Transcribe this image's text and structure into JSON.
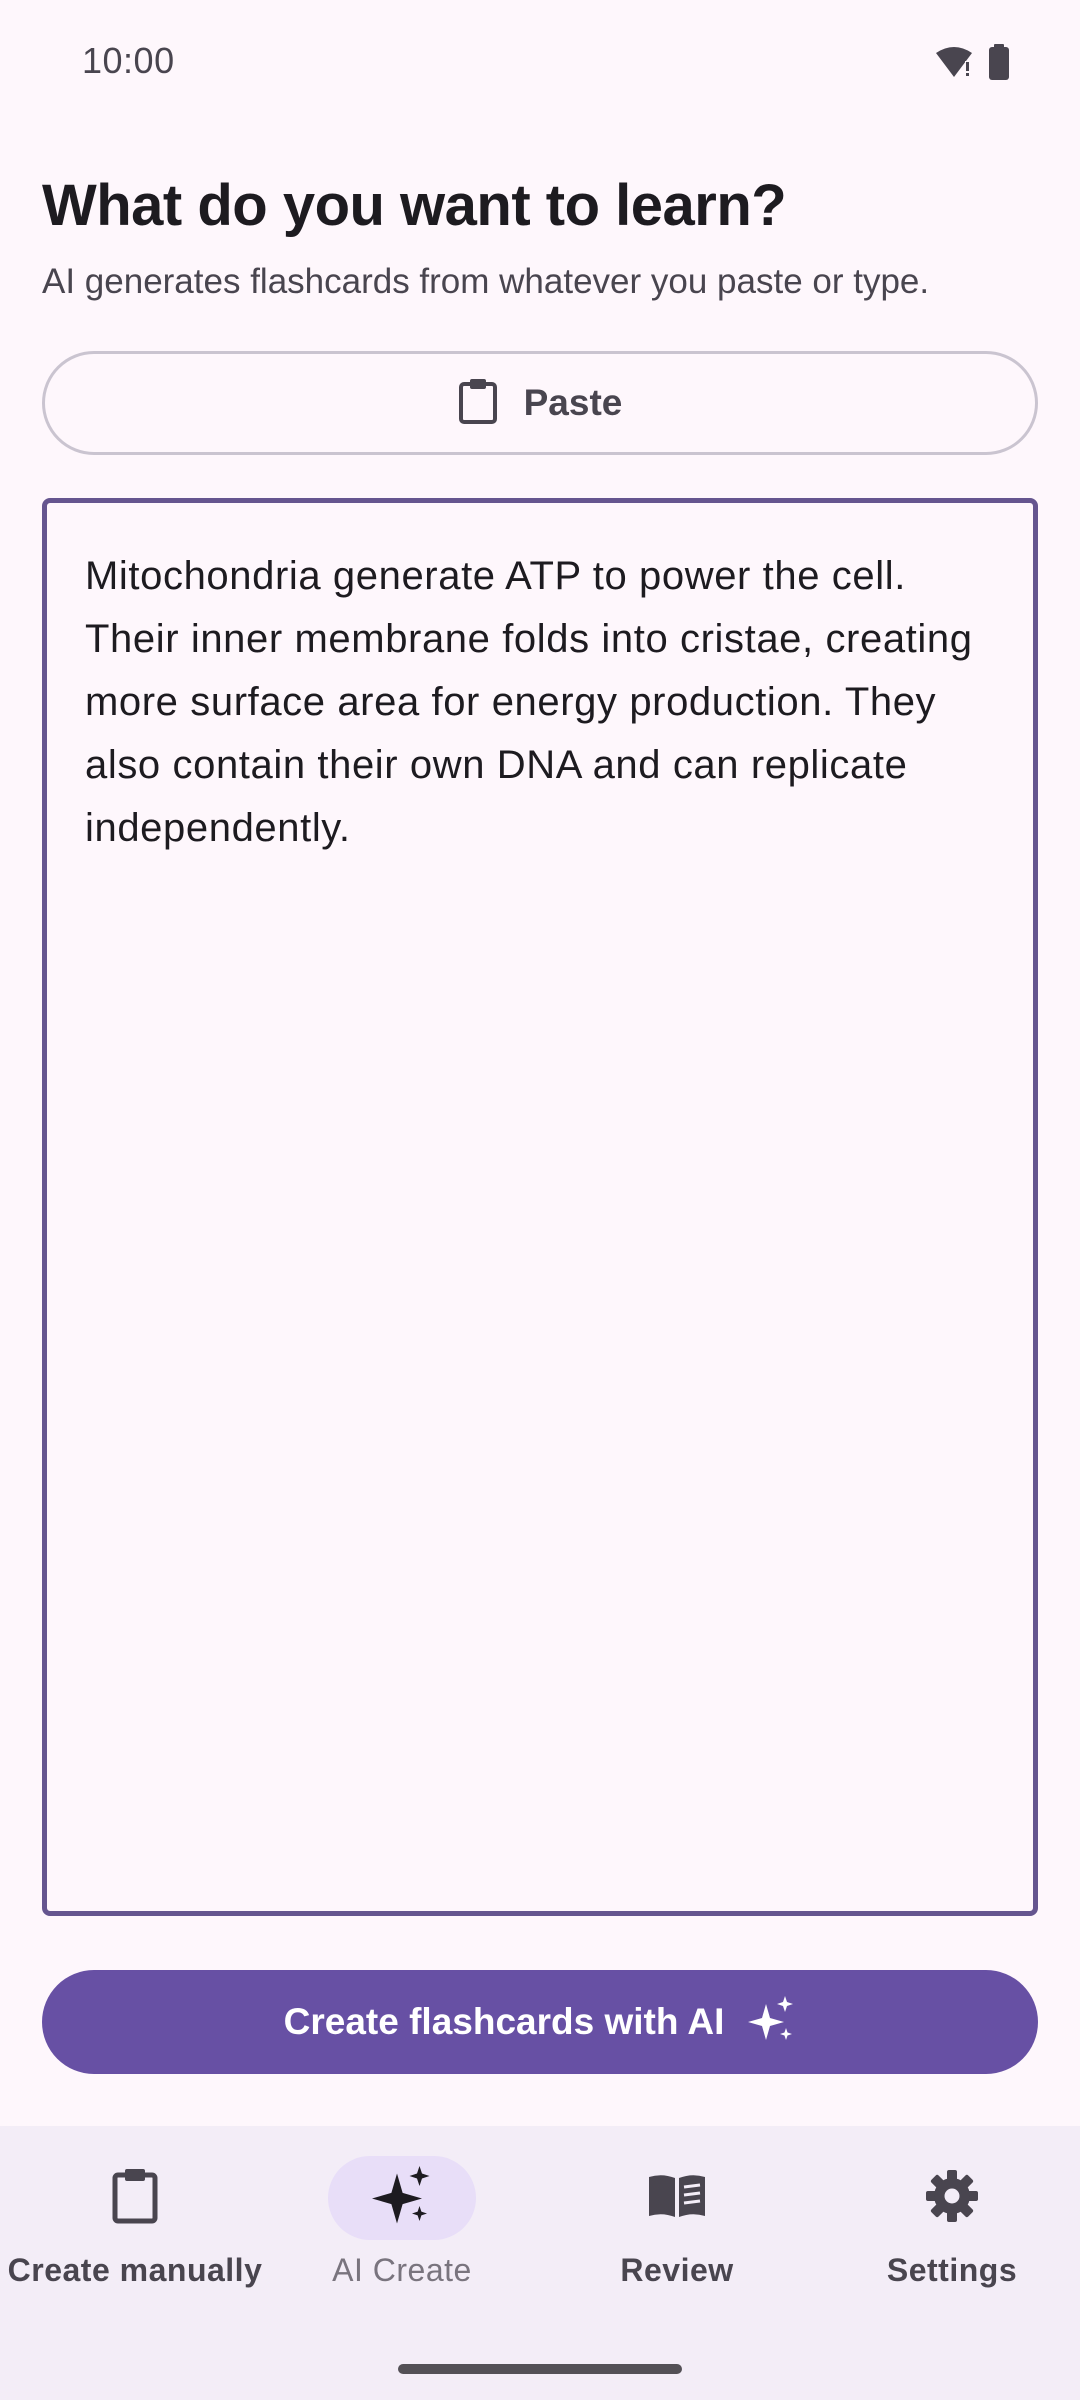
{
  "status_bar": {
    "time": "10:00",
    "icons": [
      "wifi-alert-icon",
      "battery-icon"
    ]
  },
  "header": {
    "title": "What do you want to learn?",
    "subtitle": "AI generates flashcards from whatever you paste or type."
  },
  "paste_button": {
    "label": "Paste",
    "icon": "clipboard-icon"
  },
  "input": {
    "value": "Mitochondria generate ATP to power the cell. Their inner membrane folds into cristae, creating more surface area for energy production. They also contain their own DNA and can replicate independently."
  },
  "primary_action": {
    "label": "Create flashcards with AI",
    "icon": "sparkles-icon"
  },
  "bottom_nav": {
    "items": [
      {
        "label": "Create manually",
        "icon": "clipboard-icon",
        "active": false
      },
      {
        "label": "AI Create",
        "icon": "sparkles-icon",
        "active": true
      },
      {
        "label": "Review",
        "icon": "book-icon",
        "active": false
      },
      {
        "label": "Settings",
        "icon": "gear-icon",
        "active": false
      }
    ]
  },
  "colors": {
    "primary": "#6750A4",
    "text_field_border": "#65558F",
    "background": "#FEF7FC",
    "nav_background": "#F3EDF7",
    "active_pill": "#E8DEF8"
  }
}
